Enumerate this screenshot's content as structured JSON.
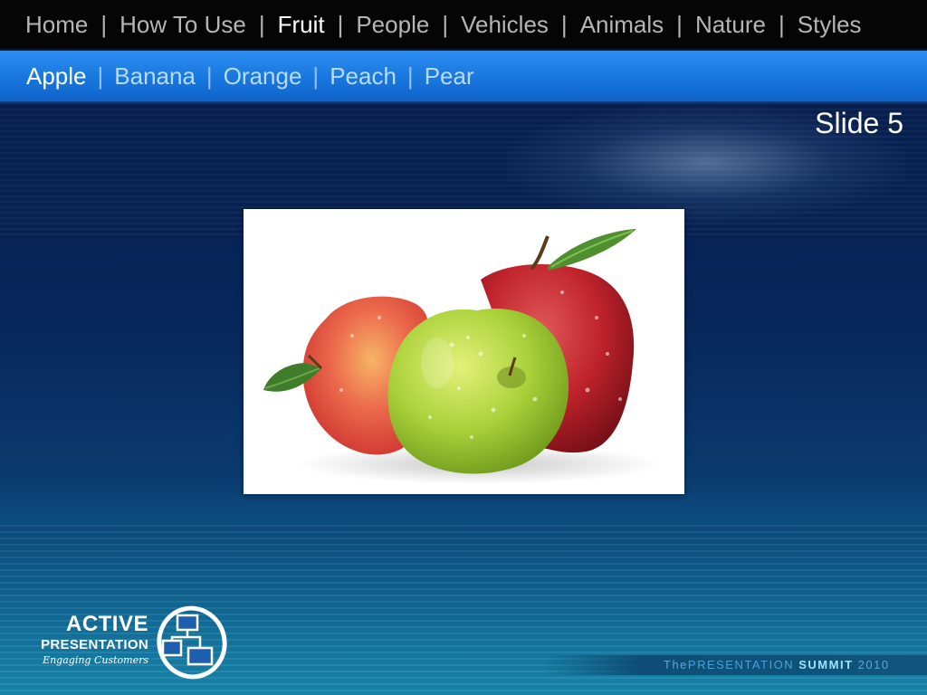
{
  "topnav": {
    "items": [
      "Home",
      "How To Use",
      "Fruit",
      "People",
      "Vehicles",
      "Animals",
      "Nature",
      "Styles"
    ],
    "separator": "|",
    "active": "Fruit"
  },
  "subnav": {
    "items": [
      "Apple",
      "Banana",
      "Orange",
      "Peach",
      "Pear"
    ],
    "separator": "|",
    "active": "Apple"
  },
  "slide": {
    "label": "Slide 5"
  },
  "logo": {
    "line1": "ACTIVE",
    "line2": "PRESENTATION",
    "tagline": "Engaging Customers"
  },
  "footer": {
    "part1": "The",
    "part2": "PRESENTATION",
    "part3": "SUMMIT",
    "part4": "2010"
  },
  "colors": {
    "topnav_bg": "#050505",
    "subnav_bg": "#1877de",
    "slide_bg": "#08265a",
    "active_text": "#ffffff"
  }
}
